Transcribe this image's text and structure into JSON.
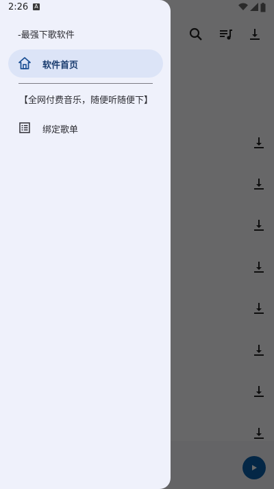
{
  "status_bar": {
    "time": "2:26",
    "notification_icon": "a-app-icon"
  },
  "drawer": {
    "header": "-最强下歌软件",
    "items": [
      {
        "label": "软件首页",
        "icon": "home-icon",
        "active": true
      },
      {
        "label": "绑定歌单",
        "icon": "list-icon",
        "active": false
      }
    ],
    "tagline": "【全网付费音乐，随便听随便下】"
  },
  "app": {
    "toolbar_icons": [
      "search-icon",
      "queue-music-icon",
      "download-icon"
    ],
    "download_rows": 8,
    "colors": {
      "accent": "#0b5ea8",
      "drawer_bg": "#eff1fb",
      "active_item": "#dce4f7"
    }
  }
}
